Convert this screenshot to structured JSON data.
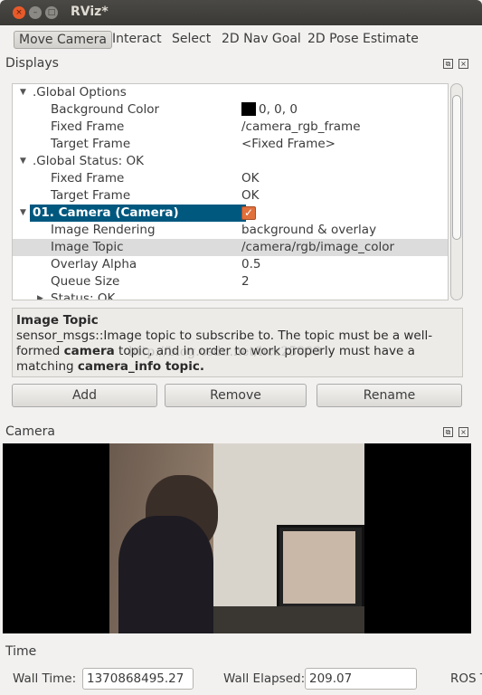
{
  "window": {
    "title": "RViz*"
  },
  "toolbar": {
    "tools": [
      "Move Camera",
      "Interact",
      "Select",
      "2D Nav Goal",
      "2D Pose Estimate"
    ],
    "active": "Move Camera"
  },
  "displays": {
    "title": "Displays",
    "rows": [
      {
        "label": ".Global Options",
        "value": "",
        "expanded": true
      },
      {
        "label": "Background Color",
        "value": "0, 0, 0",
        "swatch": "#000000"
      },
      {
        "label": "Fixed Frame",
        "value": "/camera_rgb_frame"
      },
      {
        "label": "Target Frame",
        "value": "<Fixed Frame>"
      },
      {
        "label": ".Global Status: OK",
        "value": "",
        "expanded": true
      },
      {
        "label": "Fixed Frame",
        "value": "OK"
      },
      {
        "label": "Target Frame",
        "value": "OK"
      },
      {
        "label": "01. Camera (Camera)",
        "value": "",
        "expanded": true,
        "checked": true
      },
      {
        "label": "Image Rendering",
        "value": "background & overlay"
      },
      {
        "label": "Image Topic",
        "value": "/camera/rgb/image_color"
      },
      {
        "label": "Overlay Alpha",
        "value": "0.5"
      },
      {
        "label": "Queue Size",
        "value": "2"
      },
      {
        "label": "Status: OK",
        "value": "",
        "expanded": false
      }
    ],
    "description": {
      "title": "Image Topic",
      "p1": "sensor_msgs::Image topic to subscribe to. The topic must be a well-formed ",
      "b1": "camera",
      "p2": " topic, and in order to work properly must have a matching ",
      "b2": "camera_info topic.",
      "watermark": "http://blog.csdn.net/hcx25909"
    },
    "buttons": {
      "add": "Add",
      "remove": "Remove",
      "rename": "Rename"
    }
  },
  "camera": {
    "title": "Camera"
  },
  "time": {
    "title": "Time",
    "wall_time_label": "Wall Time:",
    "wall_time": "1370868495.27",
    "wall_elapsed_label": "Wall Elapsed:",
    "wall_elapsed": "209.07",
    "ros_time_label": "ROS T"
  },
  "colors": {
    "selection": "#00587f",
    "checkbox": "#e0703c",
    "titlebar": "#3c3b37"
  }
}
